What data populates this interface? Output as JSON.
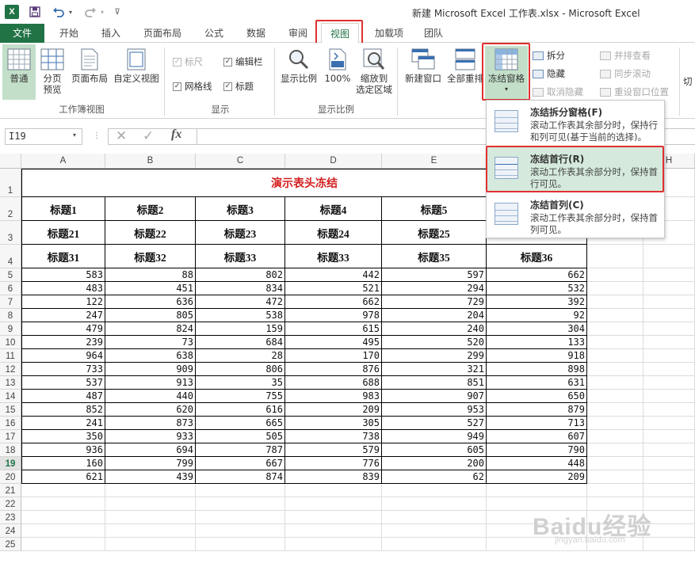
{
  "window": {
    "title": "新建 Microsoft Excel 工作表.xlsx - Microsoft Excel",
    "app_logo": "X"
  },
  "quick_access": {
    "save_icon": "save-icon",
    "undo_icon": "undo-icon",
    "redo_icon": "redo-icon"
  },
  "tabs": [
    "文件",
    "开始",
    "插入",
    "页面布局",
    "公式",
    "数据",
    "审阅",
    "视图",
    "加载项",
    "团队"
  ],
  "active_tab": "视图",
  "ribbon": {
    "workbook_views": {
      "normal": "普通",
      "page_break": "分页\n预览",
      "page_layout": "页面布局",
      "custom_view": "自定义视图",
      "group": "工作簿视图"
    },
    "show": {
      "ruler": "标尺",
      "formula_bar": "编辑栏",
      "gridlines": "网格线",
      "headings": "标题",
      "group": "显示"
    },
    "zoom": {
      "zoom": "显示比例",
      "hundred": "100%",
      "zoom_selection": "缩放到\n选定区域",
      "group": "显示比例"
    },
    "window": {
      "new_window": "新建窗口",
      "arrange_all": "全部重排",
      "freeze_panes": "冻结窗格",
      "split": "拆分",
      "hide": "隐藏",
      "unhide": "取消隐藏",
      "side_by_side": "并排查看",
      "sync_scroll": "同步滚动",
      "reset_position": "重设窗口位置",
      "switch": "切"
    }
  },
  "formula_bar": {
    "name_box": "I19",
    "fx": "fx",
    "value": ""
  },
  "columns": [
    "A",
    "B",
    "C",
    "D",
    "E",
    "F",
    "G",
    "H"
  ],
  "rows": [
    "1",
    "2",
    "3",
    "4",
    "5",
    "6",
    "7",
    "8",
    "9",
    "10",
    "11",
    "12",
    "13",
    "14",
    "15",
    "16",
    "17",
    "18",
    "19",
    "20",
    "21",
    "22",
    "23",
    "24",
    "25"
  ],
  "selected_row": "19",
  "sheet": {
    "title": "演示表头冻结",
    "header_rows": [
      [
        "标题1",
        "标题2",
        "标题3",
        "标题4",
        "标题5",
        ""
      ],
      [
        "标题21",
        "标题22",
        "标题23",
        "标题24",
        "标题25",
        ""
      ],
      [
        "标题31",
        "标题32",
        "标题33",
        "标题33",
        "标题35",
        "标题36"
      ]
    ],
    "data": [
      [
        583,
        88,
        802,
        442,
        597,
        662
      ],
      [
        483,
        451,
        834,
        521,
        294,
        532
      ],
      [
        122,
        636,
        472,
        662,
        729,
        392
      ],
      [
        247,
        805,
        538,
        978,
        204,
        92
      ],
      [
        479,
        824,
        159,
        615,
        240,
        304
      ],
      [
        239,
        73,
        684,
        495,
        520,
        133
      ],
      [
        964,
        638,
        28,
        170,
        299,
        918
      ],
      [
        733,
        909,
        806,
        876,
        321,
        898
      ],
      [
        537,
        913,
        35,
        688,
        851,
        631
      ],
      [
        487,
        440,
        755,
        983,
        907,
        650
      ],
      [
        852,
        620,
        616,
        209,
        953,
        879
      ],
      [
        241,
        873,
        665,
        305,
        527,
        713
      ],
      [
        350,
        933,
        505,
        738,
        949,
        607
      ],
      [
        936,
        694,
        787,
        579,
        605,
        790
      ],
      [
        160,
        799,
        667,
        776,
        200,
        448
      ],
      [
        621,
        439,
        874,
        839,
        62,
        209
      ]
    ]
  },
  "freeze_menu": [
    {
      "title": "冻结拆分窗格(F)",
      "desc": "滚动工作表其余部分时，保持行和列可见(基于当前的选择)。"
    },
    {
      "title": "冻结首行(R)",
      "desc": "滚动工作表其余部分时，保持首行可见。"
    },
    {
      "title": "冻结首列(C)",
      "desc": "滚动工作表其余部分时，保持首列可见。"
    }
  ],
  "highlight_color": "#e03030",
  "accent_color": "#217346",
  "watermark": {
    "main": "Baidu经验",
    "sub": "jingyan.baidu.com"
  }
}
